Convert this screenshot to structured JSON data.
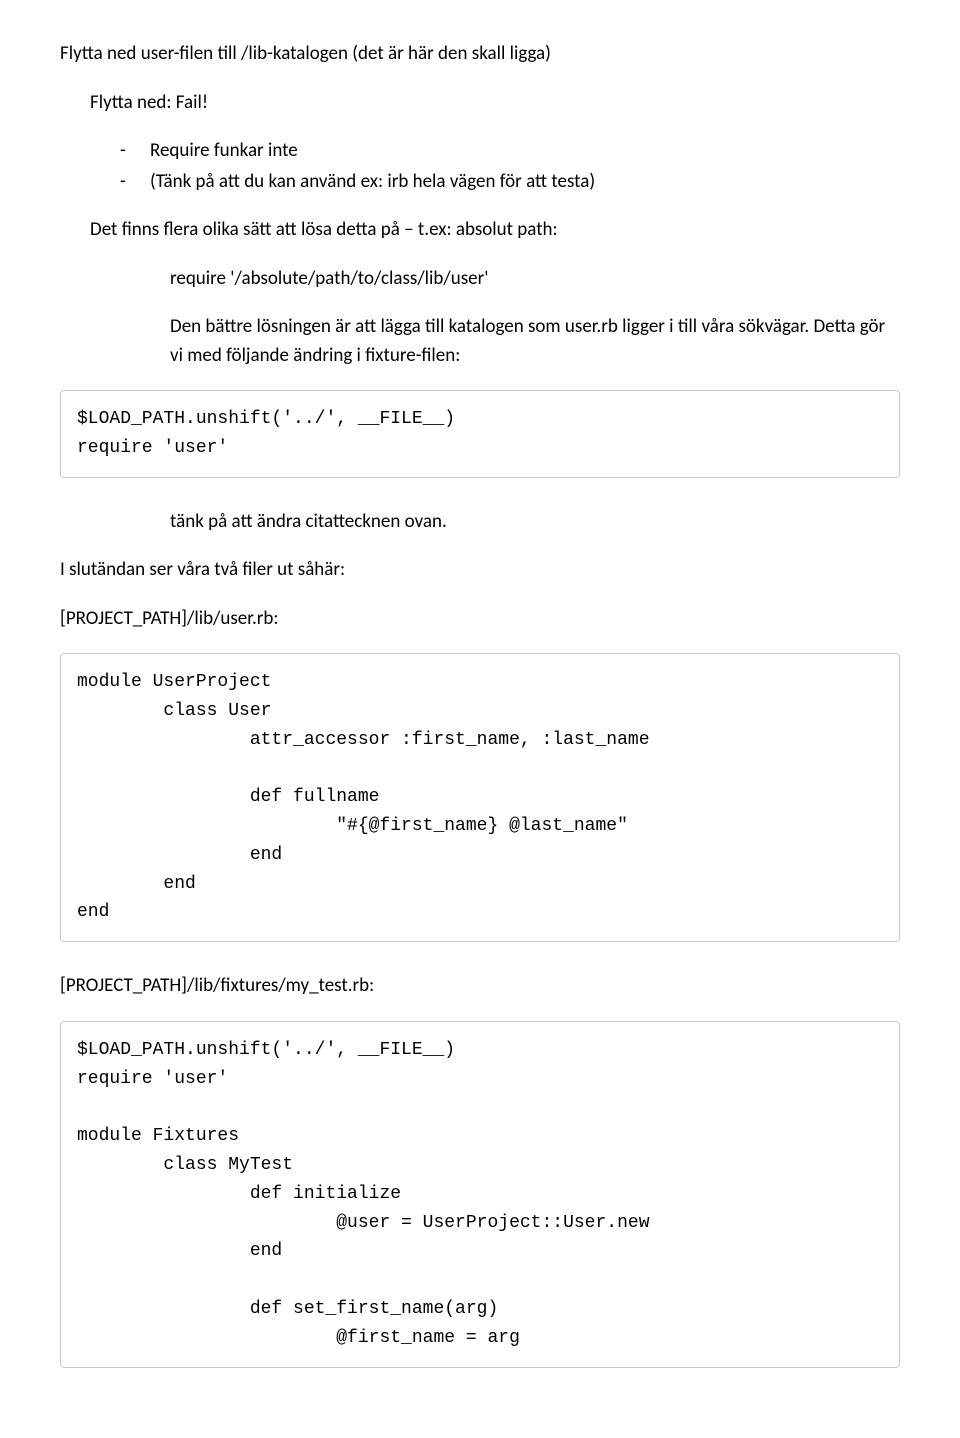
{
  "p1": "Flytta ned user-filen till /lib-katalogen (det är här den skall ligga)",
  "p2": "Flytta ned: Fail!",
  "bullets1": [
    "Require funkar inte",
    "(Tänk på att du kan använd ex: irb hela vägen för att testa)"
  ],
  "p3": "Det finns flera olika sätt att lösa detta på – t.ex: absolut path:",
  "p4": "require '/absolute/path/to/class/lib/user'",
  "p5": "Den bättre lösningen är att lägga till katalogen som user.rb ligger i till våra sökvägar. Detta gör vi med följande ändring i fixture-filen:",
  "code1": "$LOAD_PATH.unshift('../', __FILE__)\nrequire 'user'\n",
  "p6": "tänk på att ändra citattecknen ovan.",
  "p7": "I slutändan ser våra två filer ut såhär:",
  "p8": "[PROJECT_PATH]/lib/user.rb:",
  "code2": "module UserProject\n        class User\n                attr_accessor :first_name, :last_name\n\n                def fullname\n                        \"#{@first_name} @last_name\"\n                end\n        end\nend",
  "p9": "[PROJECT_PATH]/lib/fixtures/my_test.rb:",
  "code3": "$LOAD_PATH.unshift('../', __FILE__)\nrequire 'user'\n\nmodule Fixtures\n        class MyTest\n                def initialize\n                        @user = UserProject::User.new\n                end\n\n                def set_first_name(arg)\n                        @first_name = arg"
}
